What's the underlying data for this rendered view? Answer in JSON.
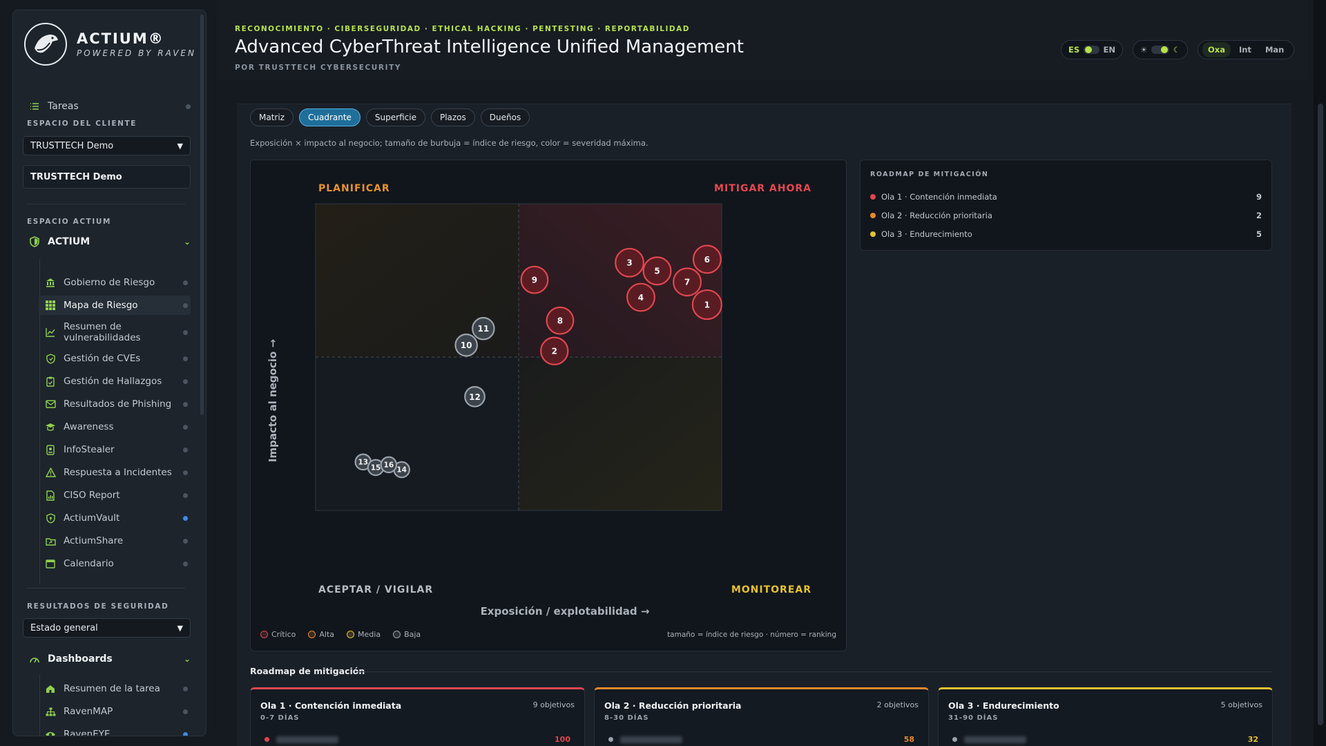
{
  "brand": {
    "name": "ACTIUM®",
    "sub": "POWERED BY RAVEN"
  },
  "sidebar": {
    "tasks_label": "Tareas",
    "client_section": "ESPACIO DEL CLIENTE",
    "client_select": "TRUSTTECH Demo",
    "client_box": "TRUSTTECH Demo",
    "actium_section": "ESPACIO ACTIUM",
    "actium_group": "ACTIUM",
    "items": [
      {
        "label": "Gobierno de Riesgo",
        "icon": "bank-icon",
        "dot": "gray"
      },
      {
        "label": "Mapa de Riesgo",
        "icon": "grid-icon",
        "dot": "gray",
        "active": true
      },
      {
        "label": "Resumen de vulnerabilidades",
        "icon": "chart-line-icon",
        "dot": "gray"
      },
      {
        "label": "Gestión de CVEs",
        "icon": "shield-icon",
        "dot": "gray"
      },
      {
        "label": "Gestión de Hallazgos",
        "icon": "clipboard-icon",
        "dot": "gray"
      },
      {
        "label": "Resultados de Phishing",
        "icon": "mail-icon",
        "dot": "gray"
      },
      {
        "label": "Awareness",
        "icon": "graduation-icon",
        "dot": "gray"
      },
      {
        "label": "InfoStealer",
        "icon": "badge-icon",
        "dot": "gray"
      },
      {
        "label": "Respuesta a Incidentes",
        "icon": "warning-icon",
        "dot": "gray"
      },
      {
        "label": "CISO Report",
        "icon": "report-icon",
        "dot": "gray"
      },
      {
        "label": "ActiumVault",
        "icon": "vault-icon",
        "dot": "blue"
      },
      {
        "label": "ActiumShare",
        "icon": "share-icon",
        "dot": "gray"
      },
      {
        "label": "Calendario",
        "icon": "calendar-icon",
        "dot": "gray"
      }
    ],
    "security_section": "RESULTADOS DE SEGURIDAD",
    "security_select": "Estado general",
    "dashboards_group": "Dashboards",
    "dash_items": [
      {
        "label": "Resumen de la tarea",
        "icon": "home-icon",
        "dot": "gray"
      },
      {
        "label": "RavenMAP",
        "icon": "network-icon",
        "dot": "gray"
      },
      {
        "label": "RavenEYE",
        "icon": "eye-icon",
        "dot": "blue"
      }
    ]
  },
  "header": {
    "tagline": "RECONOCIMIENTO · CIBERSEGURIDAD · ETHICAL HACKING · PENTESTING · REPORTABILIDAD",
    "title": "Advanced CyberThreat Intelligence Unified Management",
    "byline": "POR TRUSTTECH CYBERSECURITY",
    "lang_left": "ES",
    "lang_right": "EN",
    "theme_left": "☀",
    "theme_right": "☾",
    "modes": [
      "Oxa",
      "Int",
      "Man"
    ],
    "active_mode": "Oxa"
  },
  "tabs": [
    {
      "label": "Matriz",
      "active": false
    },
    {
      "label": "Cuadrante",
      "active": true
    },
    {
      "label": "Superficie",
      "active": false
    },
    {
      "label": "Plazos",
      "active": false
    },
    {
      "label": "Dueños",
      "active": false
    }
  ],
  "description": "Exposición × impacto al negocio; tamaño de burbuja = índice de riesgo, color = severidad máxima.",
  "chart_data": {
    "type": "scatter",
    "xlabel": "Exposición / explotabilidad →",
    "ylabel": "Impacto al negocio →",
    "quadrants": {
      "top_left": "PLANIFICAR",
      "top_right": "MITIGAR AHORA",
      "bottom_left": "ACEPTAR / VIGILAR",
      "bottom_right": "MONITOREAR"
    },
    "xlim": [
      0,
      1
    ],
    "ylim": [
      0,
      1
    ],
    "colors": {
      "Crítico": "#e0464f",
      "Alta": "#e8892b",
      "Media": "#e6c12e",
      "Baja": "#9aa2ab"
    },
    "points": [
      {
        "rank": 1,
        "x": 0.964,
        "y": 0.671,
        "risk": 100,
        "severity": "Crítico"
      },
      {
        "rank": 2,
        "x": 0.588,
        "y": 0.52,
        "risk": 90,
        "severity": "Crítico"
      },
      {
        "rank": 3,
        "x": 0.773,
        "y": 0.808,
        "risk": 95,
        "severity": "Crítico"
      },
      {
        "rank": 4,
        "x": 0.801,
        "y": 0.695,
        "risk": 92,
        "severity": "Crítico"
      },
      {
        "rank": 5,
        "x": 0.841,
        "y": 0.781,
        "risk": 92,
        "severity": "Crítico"
      },
      {
        "rank": 6,
        "x": 0.964,
        "y": 0.819,
        "risk": 92,
        "severity": "Crítico"
      },
      {
        "rank": 7,
        "x": 0.915,
        "y": 0.745,
        "risk": 92,
        "severity": "Crítico"
      },
      {
        "rank": 8,
        "x": 0.602,
        "y": 0.619,
        "risk": 88,
        "severity": "Crítico"
      },
      {
        "rank": 9,
        "x": 0.539,
        "y": 0.752,
        "risk": 88,
        "severity": "Crítico"
      },
      {
        "rank": 10,
        "x": 0.371,
        "y": 0.539,
        "risk": 62,
        "severity": "Baja"
      },
      {
        "rank": 11,
        "x": 0.413,
        "y": 0.593,
        "risk": 62,
        "severity": "Baja"
      },
      {
        "rank": 12,
        "x": 0.392,
        "y": 0.371,
        "risk": 52,
        "severity": "Baja"
      },
      {
        "rank": 13,
        "x": 0.117,
        "y": 0.158,
        "risk": 30,
        "severity": "Baja"
      },
      {
        "rank": 14,
        "x": 0.212,
        "y": 0.133,
        "risk": 30,
        "severity": "Baja"
      },
      {
        "rank": 15,
        "x": 0.148,
        "y": 0.14,
        "risk": 30,
        "severity": "Baja"
      },
      {
        "rank": 16,
        "x": 0.18,
        "y": 0.149,
        "risk": 30,
        "severity": "Baja"
      }
    ],
    "legend": [
      "Crítico",
      "Alta",
      "Media",
      "Baja"
    ],
    "note": "tamaño = índice de riesgo · número = ranking"
  },
  "roadmap_panel": {
    "title": "ROADMAP DE MITIGACIÓN",
    "items": [
      {
        "label": "Ola 1 · Contención inmediata",
        "count": "9",
        "color": "#e0464f"
      },
      {
        "label": "Ola 2 · Reducción prioritaria",
        "count": "2",
        "color": "#e8892b"
      },
      {
        "label": "Ola 3 · Endurecimiento",
        "count": "5",
        "color": "#e6c12e"
      }
    ]
  },
  "roadmap_bottom": {
    "title": "Roadmap de mitigación",
    "waves": [
      {
        "name": "Ola 1 · Contención inmediata",
        "days": "0-7 DÍAS",
        "count": "9 objetivos",
        "color": "#e0464f",
        "score": "100"
      },
      {
        "name": "Ola 2 · Reducción prioritaria",
        "days": "8-30 DÍAS",
        "count": "2 objetivos",
        "color": "#e8892b",
        "score": "58"
      },
      {
        "name": "Ola 3 · Endurecimiento",
        "days": "31-90 DÍAS",
        "count": "5 objetivos",
        "color": "#e6c12e",
        "score": "32"
      }
    ]
  }
}
